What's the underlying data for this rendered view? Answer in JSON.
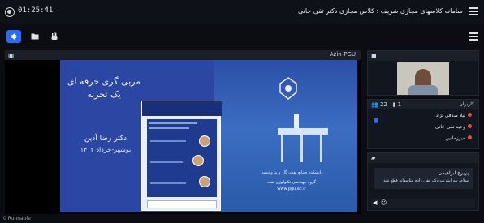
{
  "topbar": {
    "clock": "01:25:41",
    "title": "سامانه کلاسهای مجازی شریف : کلاس مجازی دکتر تقی خانی",
    "menu_icon": "hamburger-icon"
  },
  "toolbar": {
    "buttons": [
      {
        "icon": "speaker-icon",
        "glyph": "🔊",
        "active": true
      },
      {
        "icon": "folder-icon",
        "glyph": "▪"
      },
      {
        "icon": "hand-icon",
        "glyph": "✋"
      }
    ],
    "menu_icon": "hamburger-icon"
  },
  "share": {
    "label": "Azin-PGU",
    "slide": {
      "title_line1": "مربی گری حرفه ای",
      "title_line2": "یک تجربه",
      "author": "دکتر رضا آذین",
      "place_date": "بوشهر-خرداد ۱۴۰۲",
      "caption1": "دانشکده صنایع نفت، گاز و پتروشیمی",
      "caption2": "گروه مهندسی تکنولوژی نفت",
      "caption3": "www.pgu.ac.ir"
    }
  },
  "camera_panel": {
    "label": ""
  },
  "users_panel": {
    "label": "کاربران",
    "count_users": "22",
    "count_mics": "1",
    "users": [
      "لیلا صدقی نژاد",
      "وحید تقی خانی",
      "میرزمانین"
    ]
  },
  "chat_panel": {
    "message": {
      "sender": "پریرخ ابراهیمی",
      "text": "سلام، بله اینترنت دکتر تقی زاده متاسفانه قطع شد"
    }
  },
  "status_bar": {
    "text": "0 Runnable"
  }
}
